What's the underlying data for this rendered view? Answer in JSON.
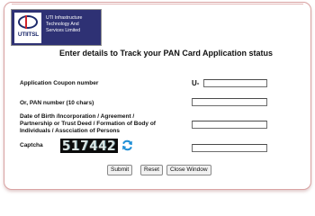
{
  "logo": {
    "word": "UTIITSL",
    "lines": [
      "UTI Infrastructure",
      "Technology And",
      "Services Limited"
    ]
  },
  "heading": "Enter details to Track your PAN Card Application status",
  "form": {
    "coupon_label": "Application Coupon number",
    "coupon_prefix": "U-",
    "coupon_value": "",
    "pan_label": "Or, PAN number (10 chars)",
    "pan_value": "",
    "dob_label_lines": [
      "Date of Birth /Incorporation / Agreement /",
      "Partnership or Trust Deed / Formation of Body of",
      "Individuals / Asscciation of Persons"
    ],
    "dob_value": "",
    "captcha_label": "Captcha",
    "captcha_text": "517442",
    "captcha_value": ""
  },
  "buttons": {
    "submit": "Submit",
    "reset": "Reset",
    "close": "Close Window"
  },
  "colors": {
    "logo_bg": "#2e3174",
    "panel_border": "#d9a3a3",
    "refresh_icon": "#1e8fd6"
  },
  "icons": {
    "refresh": "refresh-icon"
  }
}
